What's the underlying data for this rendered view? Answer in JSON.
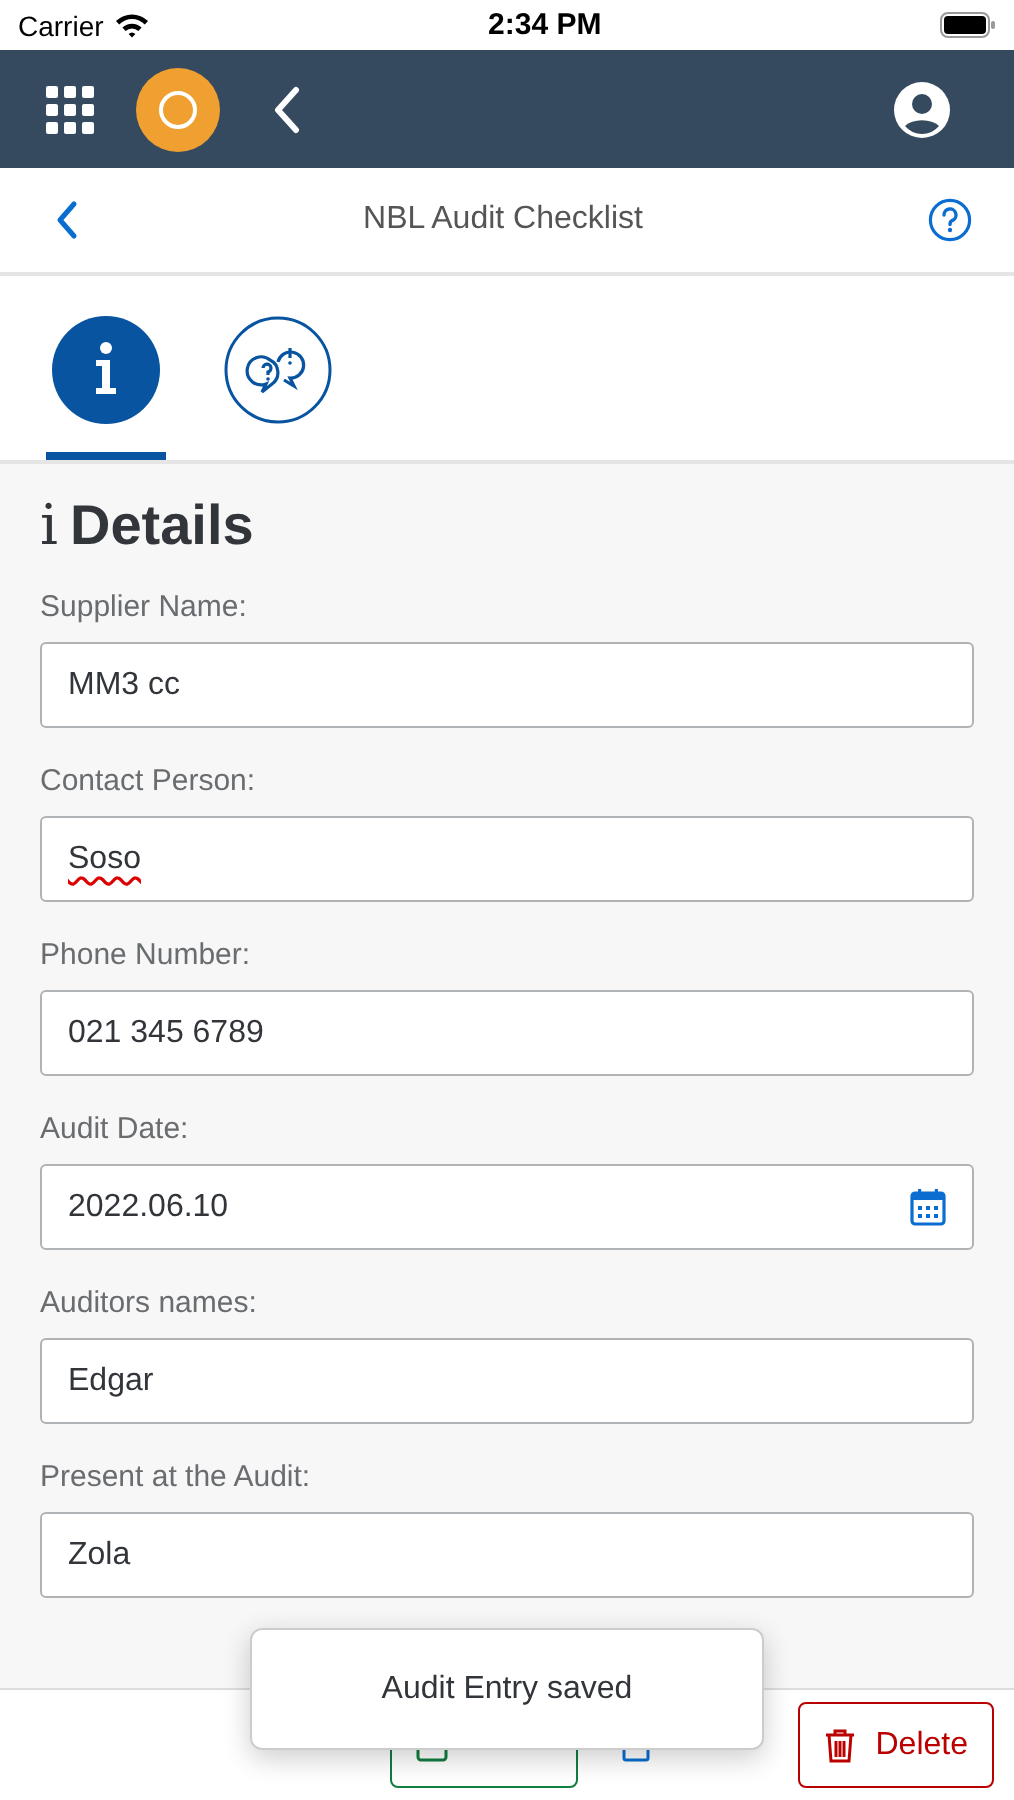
{
  "status_bar": {
    "carrier": "Carrier",
    "time": "2:34 PM"
  },
  "header": {
    "title": "NBL Audit Checklist"
  },
  "tabs": [
    {
      "kind": "info",
      "selected": true
    },
    {
      "kind": "questions",
      "selected": false
    }
  ],
  "section": {
    "icon": "i",
    "title": "Details"
  },
  "fields": [
    {
      "label": "Supplier Name:",
      "value": "MM3 cc",
      "kind": "text",
      "misspelled": false
    },
    {
      "label": "Contact Person:",
      "value": "Soso",
      "kind": "text",
      "misspelled": true
    },
    {
      "label": "Phone Number:",
      "value": "021 345 6789",
      "kind": "text",
      "misspelled": false
    },
    {
      "label": "Audit Date:",
      "value": "2022.06.10",
      "kind": "date",
      "misspelled": false
    },
    {
      "label": "Auditors names:",
      "value": "Edgar",
      "kind": "text",
      "misspelled": false
    },
    {
      "label": "Present at the Audit:",
      "value": "Zola",
      "kind": "text",
      "misspelled": false
    }
  ],
  "footer_buttons": [
    {
      "kind": "save"
    },
    {
      "kind": "submit"
    },
    {
      "kind": "delete",
      "label": "Delete"
    }
  ],
  "toast": "Audit Entry saved"
}
